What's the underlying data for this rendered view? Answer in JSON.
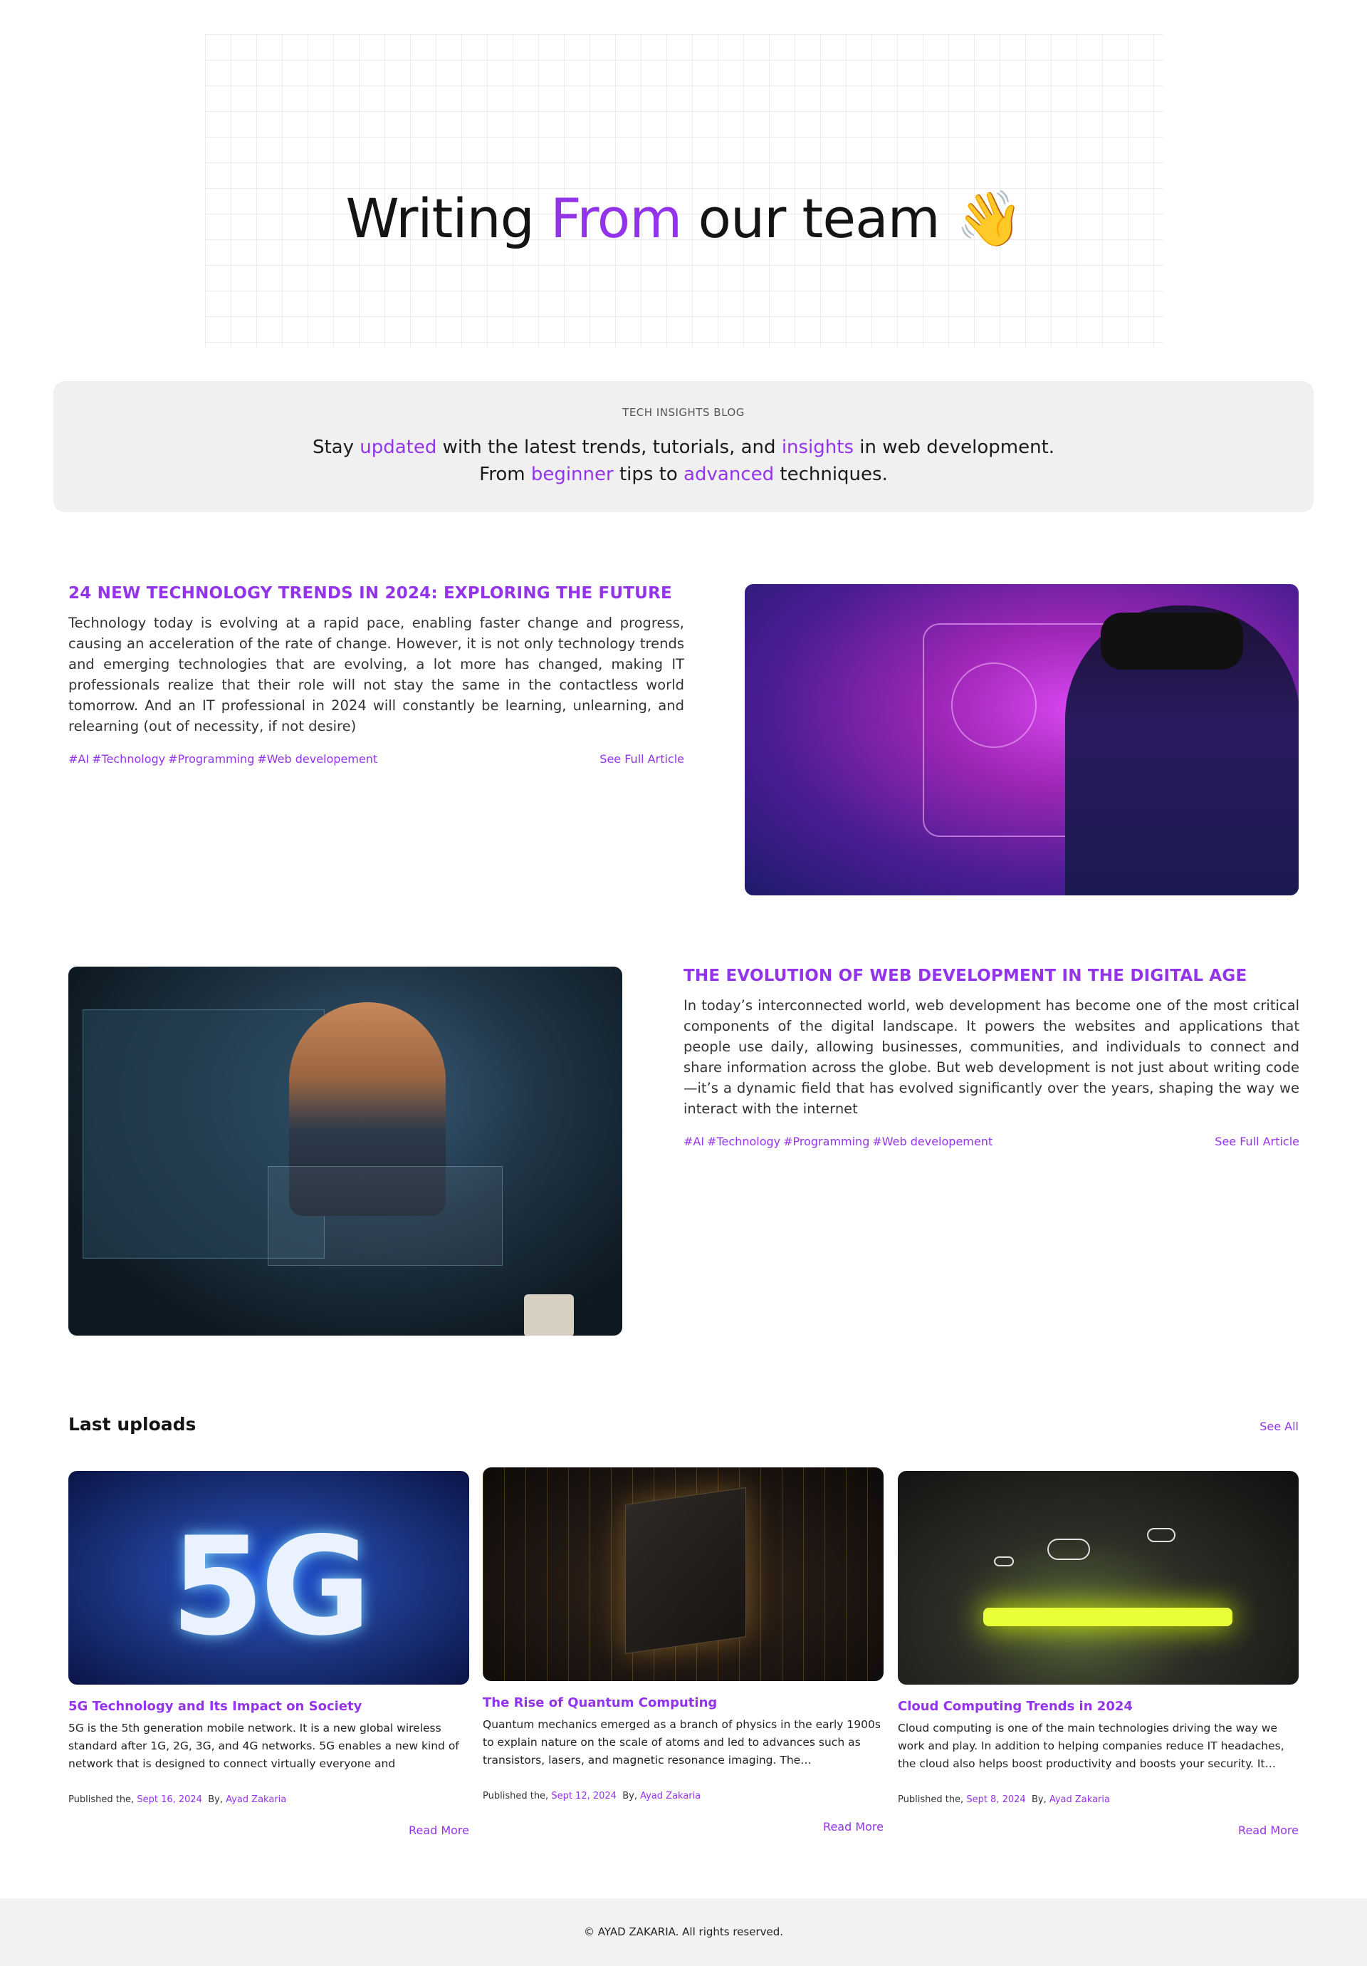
{
  "hero": {
    "title_part1": "Writing ",
    "title_accent": "From",
    "title_part2": " our team ",
    "title_emoji": "👋"
  },
  "banner": {
    "kicker": "TECH INSIGHTS BLOG",
    "line1_a": "Stay ",
    "line1_b": "updated",
    "line1_c": " with the latest trends, tutorials, and ",
    "line1_d": "insights",
    "line1_e": " in web development.",
    "line2_a": "From ",
    "line2_b": "beginner",
    "line2_c": " tips to ",
    "line2_d": "advanced",
    "line2_e": " techniques."
  },
  "featured": [
    {
      "title": "24 NEW TECHNOLOGY TRENDS IN 2024: EXPLORING THE FUTURE",
      "body": "Technology today is evolving at a rapid pace, enabling faster change and progress, causing an acceleration of the rate of change. However, it is not only technology trends and emerging technologies that are evolving, a lot more has changed, making IT professionals realize that their role will not stay the same in the contactless world tomorrow. And an IT professional in 2024 will constantly be learning, unlearning, and relearning (out of necessity, if not desire)",
      "tags": [
        "#AI",
        "#Technology",
        "#Programming",
        "#Web developement"
      ],
      "link": "See Full Article"
    },
    {
      "title": "THE EVOLUTION OF WEB DEVELOPMENT IN THE DIGITAL AGE",
      "body": "In today’s interconnected world, web development has become one of the most critical components of the digital landscape. It powers the websites and applications that people use daily, allowing businesses, communities, and individuals to connect and share information across the globe. But web development is not just about writing code—it’s a dynamic field that has evolved significantly over the years, shaping the way we interact with the internet",
      "tags": [
        "#AI",
        "#Technology",
        "#Programming",
        "#Web developement"
      ],
      "link": "See Full Article"
    }
  ],
  "last_uploads": {
    "heading": "Last uploads",
    "see_all": "See All",
    "cards": [
      {
        "image_text": "5G",
        "title": "5G Technology and Its Impact on Society",
        "body": "5G is the 5th generation mobile network. It is a new global wireless standard after 1G, 2G, 3G, and 4G networks. 5G enables a new kind of network that is designed to connect virtually everyone and everything…",
        "published_label": "Published the, ",
        "date": "Sept 16, 2024",
        "by_label": "By, ",
        "author": "Ayad Zakaria",
        "read_more": "Read More"
      },
      {
        "title": "The Rise of Quantum Computing",
        "body": "Quantum mechanics emerged as a branch of physics in the early 1900s to explain nature on the scale of atoms and led to advances such as transistors, lasers, and magnetic resonance imaging. The…",
        "published_label": "Published the, ",
        "date": "Sept 12, 2024",
        "by_label": "By, ",
        "author": "Ayad Zakaria",
        "read_more": "Read More"
      },
      {
        "title": "Cloud Computing Trends in 2024",
        "body": "Cloud computing is one of the main technologies driving the way we work and play. In addition to helping companies reduce IT headaches, the cloud also helps boost productivity and boosts your security. It…",
        "published_label": "Published the, ",
        "date": "Sept 8, 2024",
        "by_label": "By, ",
        "author": "Ayad Zakaria",
        "read_more": "Read More"
      }
    ]
  },
  "footer": {
    "text": "© AYAD ZAKARIA. All rights reserved."
  },
  "colors": {
    "accent": "#9333ea",
    "banner_bg": "#f0f0f0",
    "footer_bg": "#f2f2f2"
  }
}
